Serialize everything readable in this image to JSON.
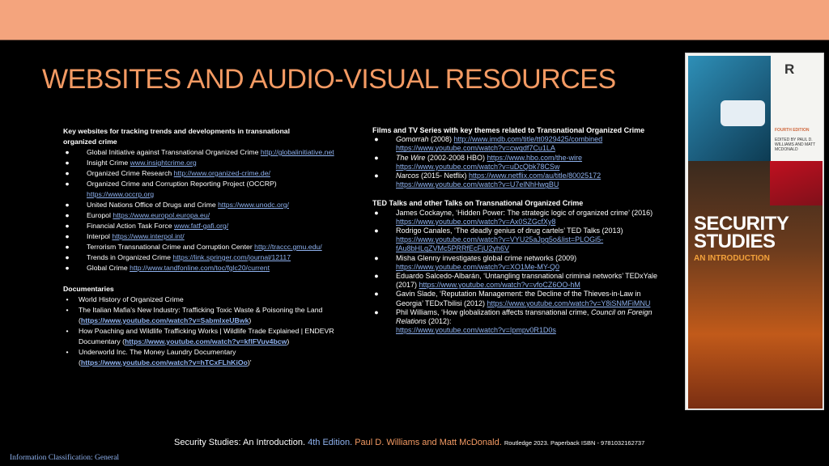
{
  "title": "WEBSITES AND AUDIO-VISUAL RESOURCES",
  "left": {
    "heading_line1": "Key websites for tracking trends and developments in transnational",
    "heading_line2": "organized crime",
    "websites": [
      {
        "text": "Global Initiative against Transnational Organized Crime ",
        "link": "http://globalinitiative.net"
      },
      {
        "text": "Insight Crime ",
        "link": "www.insightcrime.org"
      },
      {
        "text": "Organized Crime Research ",
        "link": "http://www.organized-crime.de/"
      },
      {
        "text": "Organized Crime and Corruption Reporting Project (OCCRP) ",
        "link": "https://www.occrp.org"
      },
      {
        "text": "United Nations Office of Drugs and Crime ",
        "link": "https://www.unodc.org/"
      },
      {
        "text": "Europol ",
        "link": "https://www.europol.europa.eu/"
      },
      {
        "text": "Financial Action Task Force ",
        "link": "www.fatf-gafi.org/"
      },
      {
        "text": "Interpol ",
        "link": "https://www.interpol.int/"
      },
      {
        "text": "Terrorism Transnational Crime and Corruption Center ",
        "link": "http://traccc.gmu.edu/"
      },
      {
        "text": "Trends in Organized Crime ",
        "link": "https://link.springer.com/journal/12117"
      },
      {
        "text": "Global Crime ",
        "link": "http://www.tandfonline.com/toc/fglc20/current"
      }
    ],
    "documentaries_heading": "Documentaries",
    "documentaries": [
      {
        "text": "World History of Organized Crime",
        "link": ""
      },
      {
        "text": "The Italian Mafia's New Industry: Trafficking Toxic Waste & Poisoning the Land     (",
        "link": "https://www.youtube.com/watch?v=SabmlxeUBwk",
        "after": ")"
      },
      {
        "text": "How Poaching and Wildlife Trafficking Works | Wildlife Trade Explained | ENDEVR Documentary (",
        "link": "https://www.youtube.com/watch?v=kflFVuv4bcw",
        "after": ")"
      },
      {
        "text": "Underworld Inc. The Money Laundry Documentary (",
        "link": "https://www.youtube.com/watch?v=hTCxFLhKiOo",
        "after": ")'"
      }
    ]
  },
  "right": {
    "films_heading": "Films and TV Series with key themes related to Transnational Organized Crime",
    "films": [
      {
        "title": "Gomorrah",
        "detail": " (2008) ",
        "links": [
          "http://www.imdb.com/title/tt0929425/combined",
          "https://www.youtube.com/watch?v=cwqdf7Cu1LA"
        ]
      },
      {
        "title": "The Wire",
        "detail": " (2002-2008 HBO)  ",
        "links": [
          "https://www.hbo.com/the-wire",
          "https://www.youtube.com/watch?v=uDcQbk78CSw"
        ]
      },
      {
        "title": "Narcos",
        "detail": " (2015- Netflix) ",
        "links": [
          "https://www.netflix.com/au/title/80025172",
          "https://www.youtube.com/watch?v=U7elNhHwgBU"
        ]
      }
    ],
    "ted_heading": "TED Talks and other Talks on Transnational Organized Crime",
    "ted": [
      {
        "text": "James Cockayne, ‘Hidden Power: The strategic logic of organized crime’ (2016) ",
        "link": "https://www.youtube.com/watch?v=Ax0SZGcfXy8"
      },
      {
        "text": "Rodrigo Canales, ‘The deadly genius of drug cartels’ TED Talks (2013) ",
        "link": "https://www.youtube.com/watch?v=VYU25aJpg5o&list=PLOGi5-fAu8bHLqZVMc5PRRfEcFjU2yh6V"
      },
      {
        "text": "Misha Glenny investigates global crime networks (2009) ",
        "link": "https://www.youtube.com/watch?v=XO1Me-MY-Q0"
      },
      {
        "text": "Eduardo Salcedo-Albarán, ‘Untangling transnational criminal networks’ TEDxYale (2017) ",
        "link": "https://www.youtube.com/watch?v=vfoCZ6OO-hM"
      },
      {
        "text": "Gavin Slade, ‘Reputation Management: the Decline of the Thieves-in-Law in Georgia’  TEDxTbilisi (2012) ",
        "link": "https://www.youtube.com/watch?v=Y8iSNMFiMNU"
      },
      {
        "text_a": "Phil Williams, ‘How globalization affects transnational crime, ",
        "text_i": "Council on Foreign Relations",
        "text_b": " (2012): ",
        "link": "https://www.youtube.com/watch?v=Ipmpv0R1D0s"
      }
    ]
  },
  "book": {
    "logo": "R",
    "edition": "FOURTH EDITION",
    "editors": "EDITED BY PAUL D. WILLIAMS AND MATT MCDONALD",
    "title_line1": "SECURITY",
    "title_line2": "STUDIES",
    "subtitle": "AN INTRODUCTION"
  },
  "footer": {
    "part1": "Security Studies: An Introduction. ",
    "part2": "4th Edition. ",
    "part3": "Paul D. Williams and Matt McDonald. ",
    "part4": "Routledge 2023. Paperback ISBN - 9781032162737"
  },
  "classification": "Information Classification: General",
  "colors": {
    "accent": "#f39a63",
    "topbar": "#f4a47d",
    "link": "#8fb2ef",
    "background": "#000000"
  }
}
